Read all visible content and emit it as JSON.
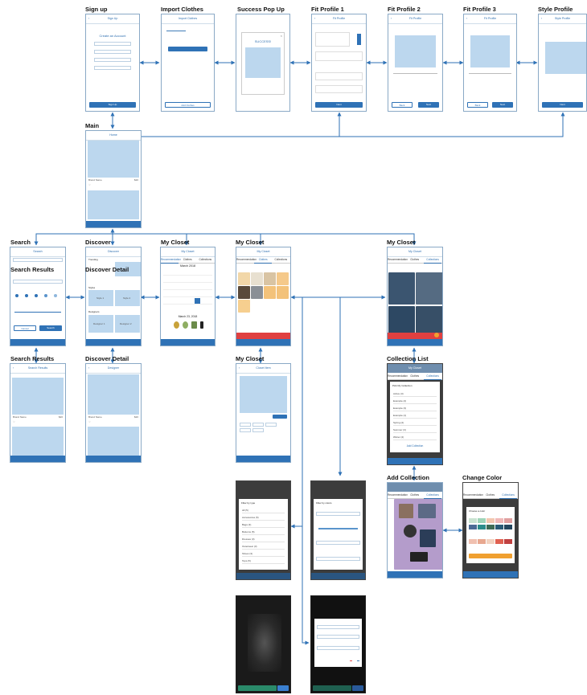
{
  "labels": {
    "sign_up": "Sign up",
    "import_clothes": "Import Clothes",
    "success_popup": "Success Pop Up",
    "fit_profile_1": "Fit Profile 1",
    "fit_profile_2": "Fit Profile 2",
    "fit_profile_3": "Fit Profile 3",
    "style_profile": "Style Profile",
    "main": "Main",
    "search": "Search",
    "discover": "Discover",
    "my_closet_1": "My Closet",
    "my_closet_2": "My Closet",
    "my_closet_3": "My Closet",
    "search_results_overlay": "Search Results",
    "discover_detail_overlay": "Discover Detail",
    "search_results": "Search Results",
    "discover_detail": "Discover Detail",
    "my_closet_item": "My Closet",
    "collection_list": "Collection List",
    "add_collection": "Add Collection",
    "change_color": "Change Color"
  },
  "screens": {
    "signup": {
      "header": "Sign Up",
      "title": "Create an Account",
      "button": "Sign Up"
    },
    "import": {
      "header": "Import Clothes",
      "button": "Add Clothes"
    },
    "success": {
      "title": "SUCCESS!"
    },
    "fit1": {
      "header": "Fit Profile",
      "button": "Next"
    },
    "fit2": {
      "header": "Fit Profile",
      "back": "Back",
      "next": "Next"
    },
    "fit3": {
      "header": "Fit Profile",
      "back": "Back",
      "next": "Next"
    },
    "style": {
      "header": "Style Profile",
      "button": "Next"
    },
    "main": {
      "header": "Home",
      "item_name": "Brand Name",
      "price": "$20"
    },
    "search": {
      "header": "Search",
      "search_label": "Search",
      "cancel": "Cancel",
      "go": "Search"
    },
    "discover": {
      "header": "Discover",
      "trending": "Trending",
      "styles": "Styles",
      "designers": "Designers",
      "style_1": "Style 1",
      "style_2": "Style 2",
      "designer_1": "Designer 1",
      "designer_2": "Designer 2"
    },
    "closet_calendar": {
      "header": "My Closet",
      "month": "March 2018",
      "date": "March 23, 2018"
    },
    "closet_clothes": {
      "header": "My Closet"
    },
    "closet_collections": {
      "header": "My Closet"
    },
    "closet_tabs": [
      "Recommendation",
      "Clothes",
      "Collections"
    ],
    "search_results_screen": {
      "header": "Search Results",
      "item_name": "Brand Name",
      "price": "$20"
    },
    "discover_detail_screen": {
      "header": "Designer",
      "item_name": "Brand Name",
      "price": "$20"
    },
    "closet_item": {
      "header": "Closet Item"
    },
    "collection_list_screen": {
      "header": "My Closet",
      "title": "Pick My Collection",
      "rows": [
        "Active (3)",
        "Example (2)",
        "Example (3)",
        "Example (1)",
        "Spring (2)",
        "Summer (3)",
        "Winter (2)"
      ],
      "add": "Add Collection"
    },
    "filter_type": {
      "title": "Filter by type",
      "rows": [
        "All (5)",
        "Accessories (5)",
        "Bags (3)",
        "Bottoms (5)",
        "Dresses (3)",
        "Outerwear (3)",
        "Shoes (3)",
        "Tops (5)"
      ]
    },
    "filter_color": {
      "title": "Filter by colors"
    },
    "change_color_screen": {
      "title": "Choose a color"
    },
    "colors": {
      "primary": "#2f72b6",
      "light": "#bcd7ee",
      "orange": "#f0a030",
      "red": "#e04040"
    }
  }
}
